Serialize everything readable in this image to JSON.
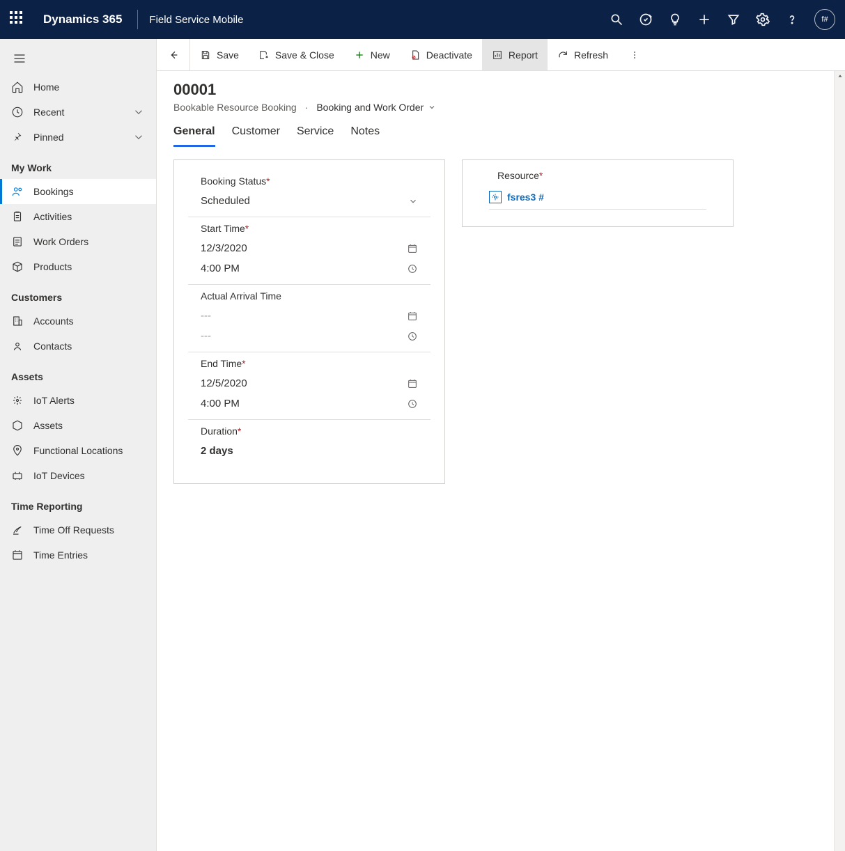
{
  "topbar": {
    "brand": "Dynamics 365",
    "app_name": "Field Service Mobile",
    "avatar_initials": "f#"
  },
  "sidebar": {
    "top": [
      {
        "label": "Home",
        "icon": "home"
      },
      {
        "label": "Recent",
        "icon": "recent",
        "chevron": true
      },
      {
        "label": "Pinned",
        "icon": "pin",
        "chevron": true
      }
    ],
    "groups": [
      {
        "title": "My Work",
        "items": [
          {
            "label": "Bookings",
            "icon": "person",
            "active": true
          },
          {
            "label": "Activities",
            "icon": "clipboard"
          },
          {
            "label": "Work Orders",
            "icon": "note"
          },
          {
            "label": "Products",
            "icon": "box"
          }
        ]
      },
      {
        "title": "Customers",
        "items": [
          {
            "label": "Accounts",
            "icon": "building"
          },
          {
            "label": "Contacts",
            "icon": "contact"
          }
        ]
      },
      {
        "title": "Assets",
        "items": [
          {
            "label": "IoT Alerts",
            "icon": "iot"
          },
          {
            "label": "Assets",
            "icon": "cube"
          },
          {
            "label": "Functional Locations",
            "icon": "locpin"
          },
          {
            "label": "IoT Devices",
            "icon": "device"
          }
        ]
      },
      {
        "title": "Time Reporting",
        "items": [
          {
            "label": "Time Off Requests",
            "icon": "timeoff"
          },
          {
            "label": "Time Entries",
            "icon": "calendar"
          }
        ]
      }
    ]
  },
  "commands": {
    "save": "Save",
    "save_close": "Save & Close",
    "new": "New",
    "deactivate": "Deactivate",
    "report": "Report",
    "refresh": "Refresh"
  },
  "record": {
    "title": "00001",
    "entity": "Bookable Resource Booking",
    "form_name": "Booking and Work Order"
  },
  "tabs": [
    "General",
    "Customer",
    "Service",
    "Notes"
  ],
  "active_tab": "General",
  "form": {
    "booking_status": {
      "label": "Booking Status",
      "required": true,
      "value": "Scheduled"
    },
    "start_time": {
      "label": "Start Time",
      "required": true,
      "date": "12/3/2020",
      "time": "4:00 PM"
    },
    "actual_arrival": {
      "label": "Actual Arrival Time",
      "required": false,
      "date": "---",
      "time": "---"
    },
    "end_time": {
      "label": "End Time",
      "required": true,
      "date": "12/5/2020",
      "time": "4:00 PM"
    },
    "duration": {
      "label": "Duration",
      "required": true,
      "value": "2 days"
    },
    "resource": {
      "label": "Resource",
      "required": true,
      "value": "fsres3 #"
    }
  }
}
